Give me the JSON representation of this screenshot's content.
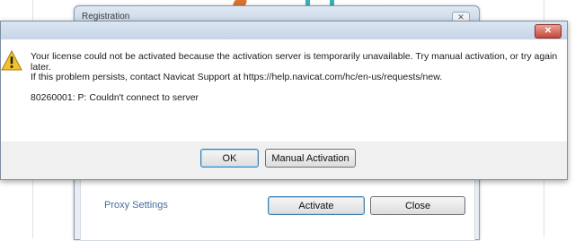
{
  "registration": {
    "title": "Registration",
    "close_glyph": "✕",
    "proxy_settings": "Proxy Settings",
    "activate_label": "Activate",
    "close_label": "Close"
  },
  "alert": {
    "close_glyph": "✕",
    "icon": "warning-icon",
    "message_line1": "Your license could not be activated because the activation server is temporarily unavailable. Try manual activation, or try again later.",
    "message_line2": "If this problem persists, contact Navicat Support at https://help.navicat.com/hc/en-us/requests/new.",
    "error_code": "80260001: P: Couldn't connect to server",
    "ok_label": "OK",
    "manual_label": "Manual Activation"
  },
  "colors": {
    "accent": "#3c7fb1",
    "warning": "#f2c12e",
    "link": "#456c9e",
    "close_red": "#c9453a"
  }
}
